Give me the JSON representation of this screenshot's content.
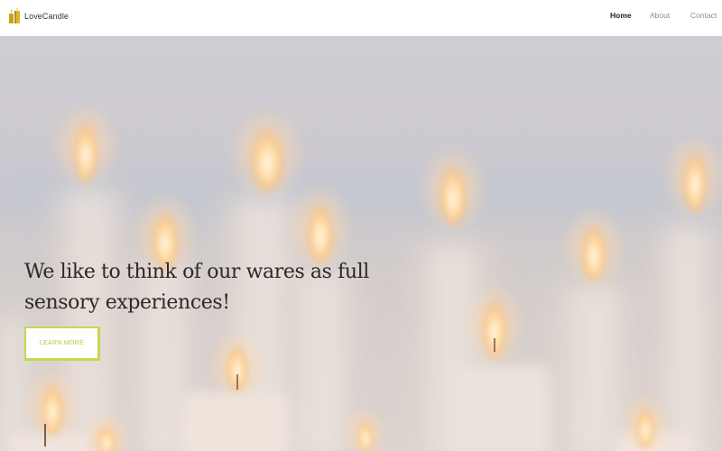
{
  "brand": {
    "name": "LoveCandle",
    "icon": "candle-logo-icon",
    "accent_color": "#c3d94f"
  },
  "nav": {
    "items": [
      {
        "label": "Home",
        "active": true
      },
      {
        "label": "About",
        "active": false
      },
      {
        "label": "Contact",
        "active": false
      }
    ]
  },
  "hero": {
    "headline": "We like to think of our wares as full sensory experiences!",
    "cta_label": "LEARN MORE",
    "background": "blurred-candles-photo"
  }
}
